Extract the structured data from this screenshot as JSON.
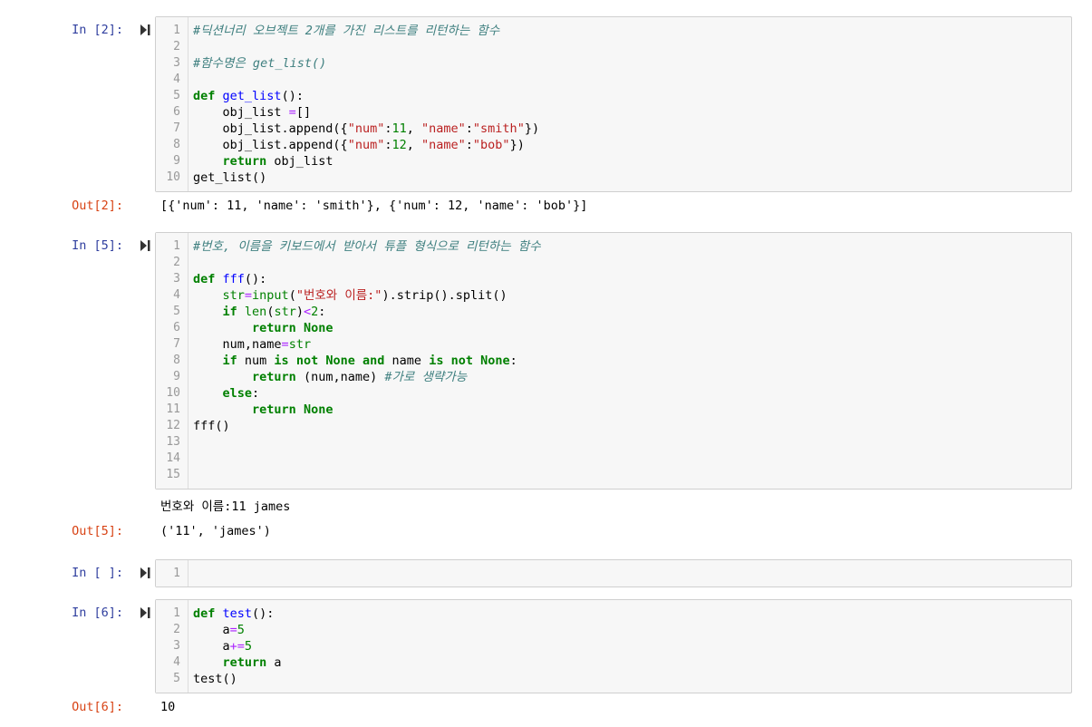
{
  "cells": [
    {
      "in_prompt": "In [2]:",
      "out_prompt": "Out[2]:",
      "lines": [
        [
          {
            "t": "cm",
            "v": "#딕션너리 오브젝트 2개를 가진 리스트를 리턴하는 함수"
          }
        ],
        [],
        [
          {
            "t": "cm",
            "v": "#함수명은 get_list()"
          }
        ],
        [],
        [
          {
            "t": "kw",
            "v": "def"
          },
          {
            "t": "",
            "v": " "
          },
          {
            "t": "fn",
            "v": "get_list"
          },
          {
            "t": "",
            "v": "():"
          }
        ],
        [
          {
            "t": "",
            "v": "    obj_list "
          },
          {
            "t": "op",
            "v": "="
          },
          {
            "t": "",
            "v": "[]"
          }
        ],
        [
          {
            "t": "",
            "v": "    obj_list.append({"
          },
          {
            "t": "str",
            "v": "\"num\""
          },
          {
            "t": "",
            "v": ":"
          },
          {
            "t": "num",
            "v": "11"
          },
          {
            "t": "",
            "v": ", "
          },
          {
            "t": "str",
            "v": "\"name\""
          },
          {
            "t": "",
            "v": ":"
          },
          {
            "t": "str",
            "v": "\"smith\""
          },
          {
            "t": "",
            "v": "})"
          }
        ],
        [
          {
            "t": "",
            "v": "    obj_list.append({"
          },
          {
            "t": "str",
            "v": "\"num\""
          },
          {
            "t": "",
            "v": ":"
          },
          {
            "t": "num",
            "v": "12"
          },
          {
            "t": "",
            "v": ", "
          },
          {
            "t": "str",
            "v": "\"name\""
          },
          {
            "t": "",
            "v": ":"
          },
          {
            "t": "str",
            "v": "\"bob\""
          },
          {
            "t": "",
            "v": "})"
          }
        ],
        [
          {
            "t": "",
            "v": "    "
          },
          {
            "t": "kw",
            "v": "return"
          },
          {
            "t": "",
            "v": " obj_list"
          }
        ],
        [
          {
            "t": "",
            "v": "get_list()"
          }
        ]
      ],
      "stdout": "",
      "output": "[{'num': 11, 'name': 'smith'}, {'num': 12, 'name': 'bob'}]"
    },
    {
      "in_prompt": "In [5]:",
      "out_prompt": "Out[5]:",
      "lines": [
        [
          {
            "t": "cm",
            "v": "#번호, 이름을 키보드에서 받아서 튜플 형식으로 리턴하는 함수"
          }
        ],
        [],
        [
          {
            "t": "kw",
            "v": "def"
          },
          {
            "t": "",
            "v": " "
          },
          {
            "t": "fn",
            "v": "fff"
          },
          {
            "t": "",
            "v": "():"
          }
        ],
        [
          {
            "t": "",
            "v": "    "
          },
          {
            "t": "bi",
            "v": "str"
          },
          {
            "t": "op",
            "v": "="
          },
          {
            "t": "bi",
            "v": "input"
          },
          {
            "t": "",
            "v": "("
          },
          {
            "t": "str",
            "v": "\"번호와 이름:\""
          },
          {
            "t": "",
            "v": ").strip().split()"
          }
        ],
        [
          {
            "t": "",
            "v": "    "
          },
          {
            "t": "kw",
            "v": "if"
          },
          {
            "t": "",
            "v": " "
          },
          {
            "t": "bi",
            "v": "len"
          },
          {
            "t": "",
            "v": "("
          },
          {
            "t": "bi",
            "v": "str"
          },
          {
            "t": "",
            "v": ")"
          },
          {
            "t": "op",
            "v": "<"
          },
          {
            "t": "num",
            "v": "2"
          },
          {
            "t": "",
            "v": ":"
          }
        ],
        [
          {
            "t": "",
            "v": "        "
          },
          {
            "t": "kw",
            "v": "return"
          },
          {
            "t": "",
            "v": " "
          },
          {
            "t": "kw",
            "v": "None"
          }
        ],
        [
          {
            "t": "",
            "v": "    num,name"
          },
          {
            "t": "op",
            "v": "="
          },
          {
            "t": "bi",
            "v": "str"
          }
        ],
        [
          {
            "t": "",
            "v": "    "
          },
          {
            "t": "kw",
            "v": "if"
          },
          {
            "t": "",
            "v": " num "
          },
          {
            "t": "kw",
            "v": "is"
          },
          {
            "t": "",
            "v": " "
          },
          {
            "t": "kw",
            "v": "not"
          },
          {
            "t": "",
            "v": " "
          },
          {
            "t": "kw",
            "v": "None"
          },
          {
            "t": "",
            "v": " "
          },
          {
            "t": "kw",
            "v": "and"
          },
          {
            "t": "",
            "v": " name "
          },
          {
            "t": "kw",
            "v": "is"
          },
          {
            "t": "",
            "v": " "
          },
          {
            "t": "kw",
            "v": "not"
          },
          {
            "t": "",
            "v": " "
          },
          {
            "t": "kw",
            "v": "None"
          },
          {
            "t": "",
            "v": ":"
          }
        ],
        [
          {
            "t": "",
            "v": "        "
          },
          {
            "t": "kw",
            "v": "return"
          },
          {
            "t": "",
            "v": " (num,name) "
          },
          {
            "t": "cm",
            "v": "#가로 생략가능"
          }
        ],
        [
          {
            "t": "",
            "v": "    "
          },
          {
            "t": "kw",
            "v": "else"
          },
          {
            "t": "",
            "v": ":"
          }
        ],
        [
          {
            "t": "",
            "v": "        "
          },
          {
            "t": "kw",
            "v": "return"
          },
          {
            "t": "",
            "v": " "
          },
          {
            "t": "kw",
            "v": "None"
          }
        ],
        [
          {
            "t": "",
            "v": "fff()"
          }
        ],
        [],
        [],
        []
      ],
      "stdout": "번호와 이름:11 james",
      "output": "('11', 'james')"
    },
    {
      "in_prompt": "In [ ]:",
      "out_prompt": "",
      "lines": [
        []
      ],
      "stdout": "",
      "output": ""
    },
    {
      "in_prompt": "In [6]:",
      "out_prompt": "Out[6]:",
      "lines": [
        [
          {
            "t": "kw",
            "v": "def"
          },
          {
            "t": "",
            "v": " "
          },
          {
            "t": "fn",
            "v": "test"
          },
          {
            "t": "",
            "v": "():"
          }
        ],
        [
          {
            "t": "",
            "v": "    a"
          },
          {
            "t": "op",
            "v": "="
          },
          {
            "t": "num",
            "v": "5"
          }
        ],
        [
          {
            "t": "",
            "v": "    a"
          },
          {
            "t": "op",
            "v": "+="
          },
          {
            "t": "num",
            "v": "5"
          }
        ],
        [
          {
            "t": "",
            "v": "    "
          },
          {
            "t": "kw",
            "v": "return"
          },
          {
            "t": "",
            "v": " a"
          }
        ],
        [
          {
            "t": "",
            "v": "test()"
          }
        ]
      ],
      "stdout": "",
      "output": "10"
    }
  ],
  "colors": {
    "in_prompt": "#303f9f",
    "out_prompt": "#d84315",
    "keyword": "#008000",
    "string": "#ba2121",
    "comment": "#408080",
    "operator": "#aa22ff",
    "function": "#0000ff"
  },
  "icons": {
    "run_button": "run-cell-icon"
  }
}
